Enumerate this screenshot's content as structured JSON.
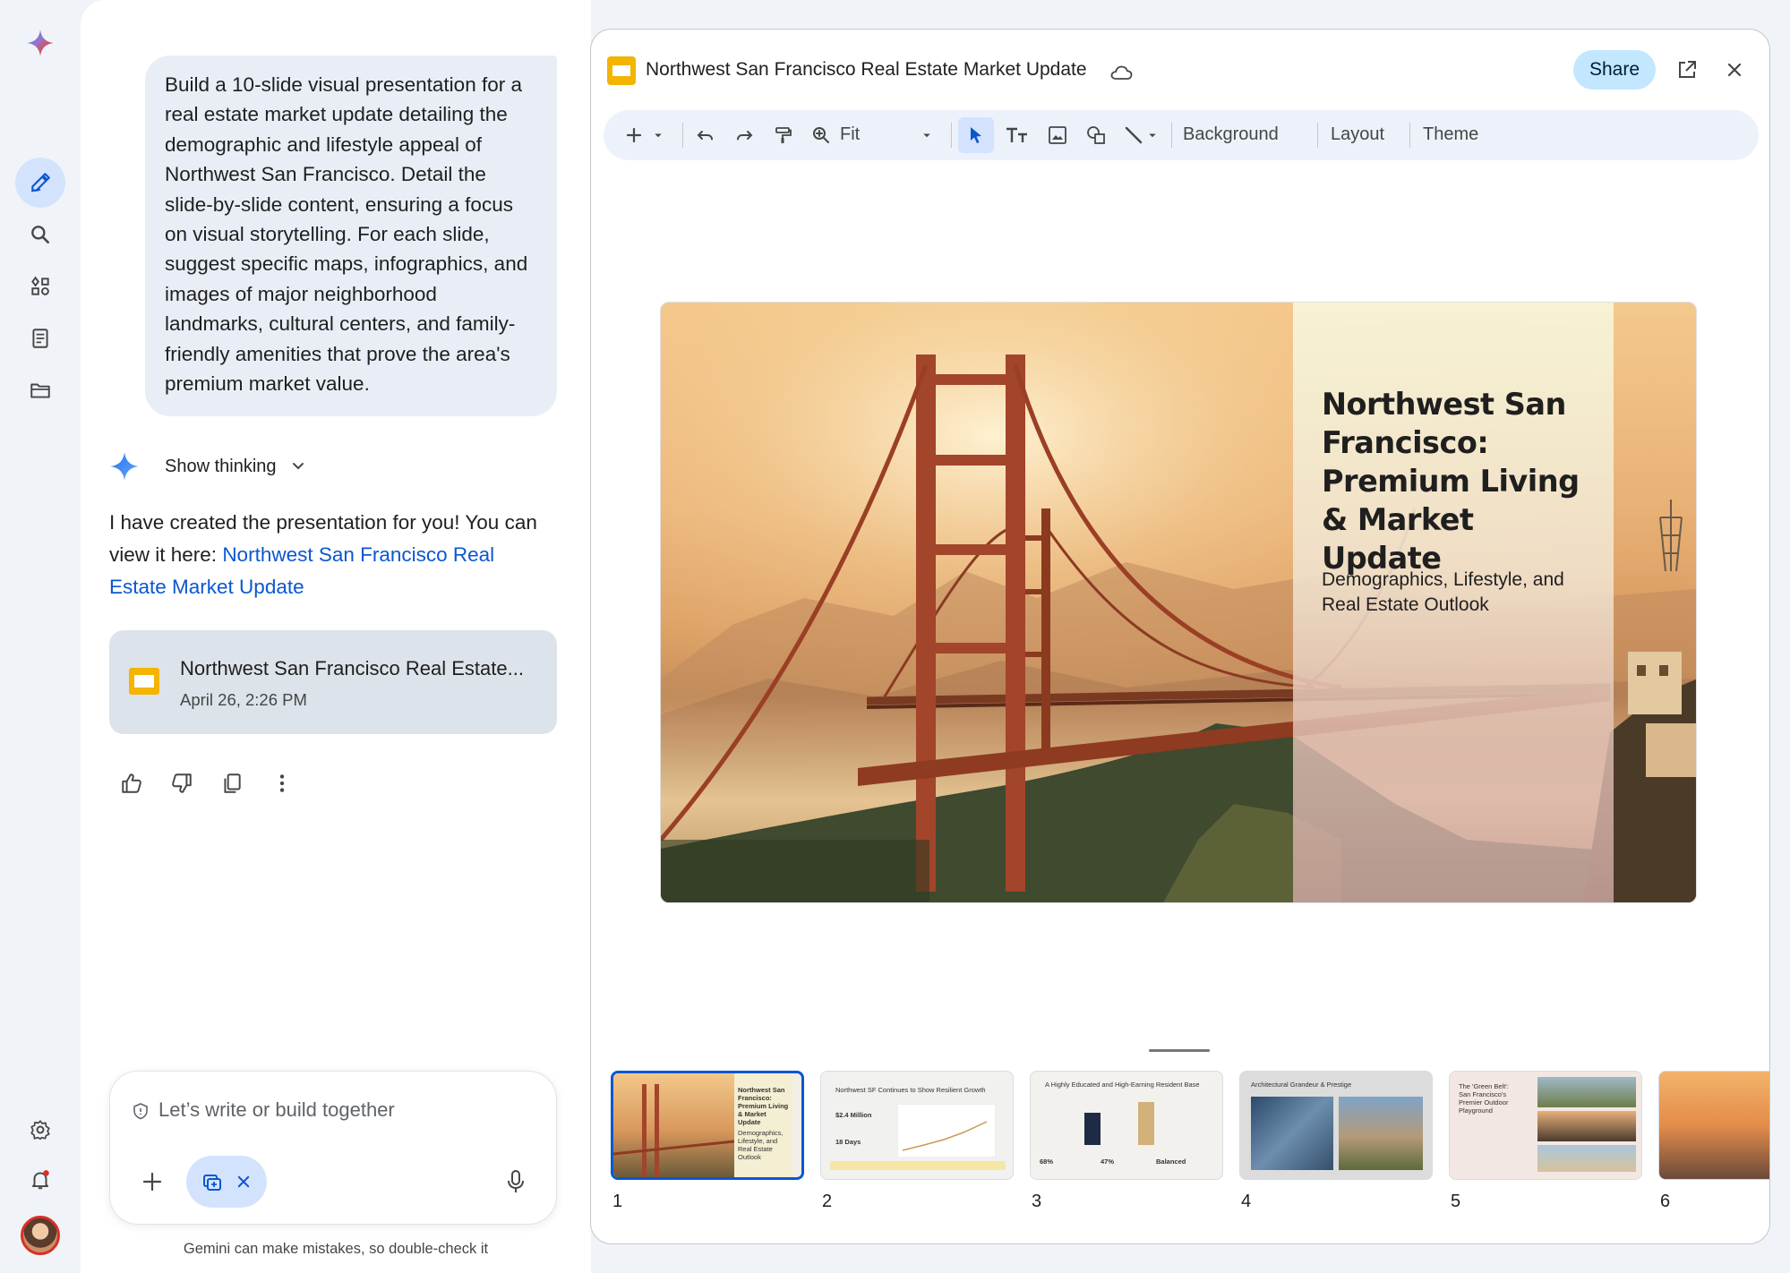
{
  "rail": {
    "items": [
      "new-chat",
      "search",
      "gems",
      "notebook",
      "files"
    ],
    "bottom": [
      "settings",
      "notifications",
      "account"
    ]
  },
  "chat": {
    "user_prompt": "Build a 10-slide visual presentation for a real estate market update detailing the demographic and lifestyle appeal of Northwest San Francisco. Detail the slide-by-slide content, ensuring a focus on visual storytelling. For each slide, suggest specific maps, infographics, and images of major neighborhood landmarks, cultural centers, and family-friendly amenities that prove the area's premium market value.",
    "show_thinking": "Show thinking",
    "reply_text": "I have created the presentation for you! You can view it here: ",
    "reply_link": "Northwest San Francisco Real Estate Market Update",
    "file_card": {
      "title": "Northwest San Francisco Real Estate...",
      "date": "April 26, 2:26 PM"
    },
    "composer_placeholder": "Let’s write or build together",
    "disclaimer": "Gemini can make mistakes, so double-check it"
  },
  "pane": {
    "doc_title": "Northwest San Francisco Real Estate Market Update",
    "share_label": "Share",
    "toolbar": {
      "zoom": "Fit",
      "background": "Background",
      "layout": "Layout",
      "theme": "Theme"
    },
    "slide": {
      "title": "Northwest San Francisco: Premium Living & Market Update",
      "subtitle": "Demographics, Lifestyle, and Real Estate Outlook"
    },
    "thumbnails": [
      {
        "num": "1",
        "title": "Northwest San Francisco: Premium Living & Market Update",
        "sub": "Demographics, Lifestyle, and Real Estate Outlook"
      },
      {
        "num": "2",
        "title": "Northwest SF Continues to Show Resilient Growth",
        "stat1": "$2.4 Million",
        "stat2": "18 Days"
      },
      {
        "num": "3",
        "title": "A Highly Educated and High-Earning Resident Base",
        "stat1": "68%",
        "stat2": "47%",
        "stat3": "Balanced"
      },
      {
        "num": "4",
        "title": "Architectural Grandeur & Prestige"
      },
      {
        "num": "5",
        "title": "The 'Green Belt': San Francisco's Premier Outdoor Playground"
      },
      {
        "num": "6"
      }
    ]
  },
  "colors": {
    "accent": "#0b57d0",
    "share_bg": "#c2e7ff",
    "slides_yellow": "#f4b400",
    "rail_bg": "#f0f4f9"
  }
}
